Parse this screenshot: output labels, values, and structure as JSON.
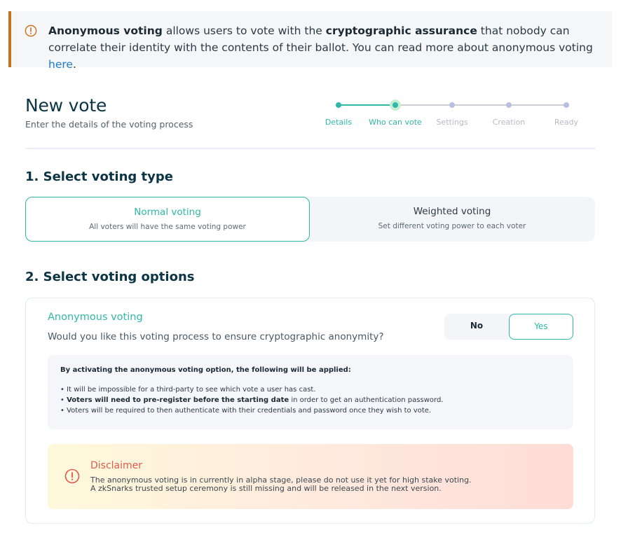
{
  "callout": {
    "bold_1": "Anonymous voting",
    "text_1": " allows users to vote with the ",
    "bold_2": "cryptographic assurance",
    "text_2": " that nobody can correlate their identity with the contents of their ballot. You can read more about anonymous voting ",
    "link": "here",
    "text_3": "."
  },
  "header": {
    "title": "New vote",
    "subtitle": "Enter the details of the voting process"
  },
  "stepper": {
    "steps": [
      "Details",
      "Who can vote",
      "Settings",
      "Creation",
      "Ready"
    ],
    "current_step": 2
  },
  "voting_type": {
    "title": "1. Select voting type",
    "options": [
      {
        "label": "Normal voting",
        "description": "All voters will have the same voting power",
        "selected": true
      },
      {
        "label": "Weighted voting",
        "description": "Set different voting power to each voter",
        "selected": false
      }
    ]
  },
  "voting_options": {
    "title": "2. Select voting options",
    "anonymous": {
      "title": "Anonymous voting",
      "question": "Would you like this voting process to ensure cryptographic anonymity?",
      "no_label": "No",
      "yes_label": "Yes",
      "selected": "Yes"
    },
    "info": {
      "heading": "By activating the anonymous voting option, the following will be applied:",
      "item_1": "It will be impossible for a third-party to see which vote a user has cast.",
      "item_2_bold": "Voters will need to pre-register before the starting date",
      "item_2_rest": " in order to get an authentication password.",
      "item_3": "Voters will be required to then authenticate with their credentials and password once they wish to vote."
    },
    "disclaimer": {
      "title": "Disclaimer",
      "line_1": "The anonymous voting is in currently in alpha stage, please do not use it yet for high stake voting.",
      "line_2": "A zkSnarks trusted setup ceremony is still missing and will be released in the next version."
    }
  },
  "colors": {
    "accent": "#2fb8a8",
    "callout_border": "#c8731e",
    "disclaimer_red": "#e05a4c",
    "link": "#1f7ac4"
  },
  "icons": {
    "callout": "info-circle-icon",
    "disclaimer": "alert-circle-icon"
  }
}
